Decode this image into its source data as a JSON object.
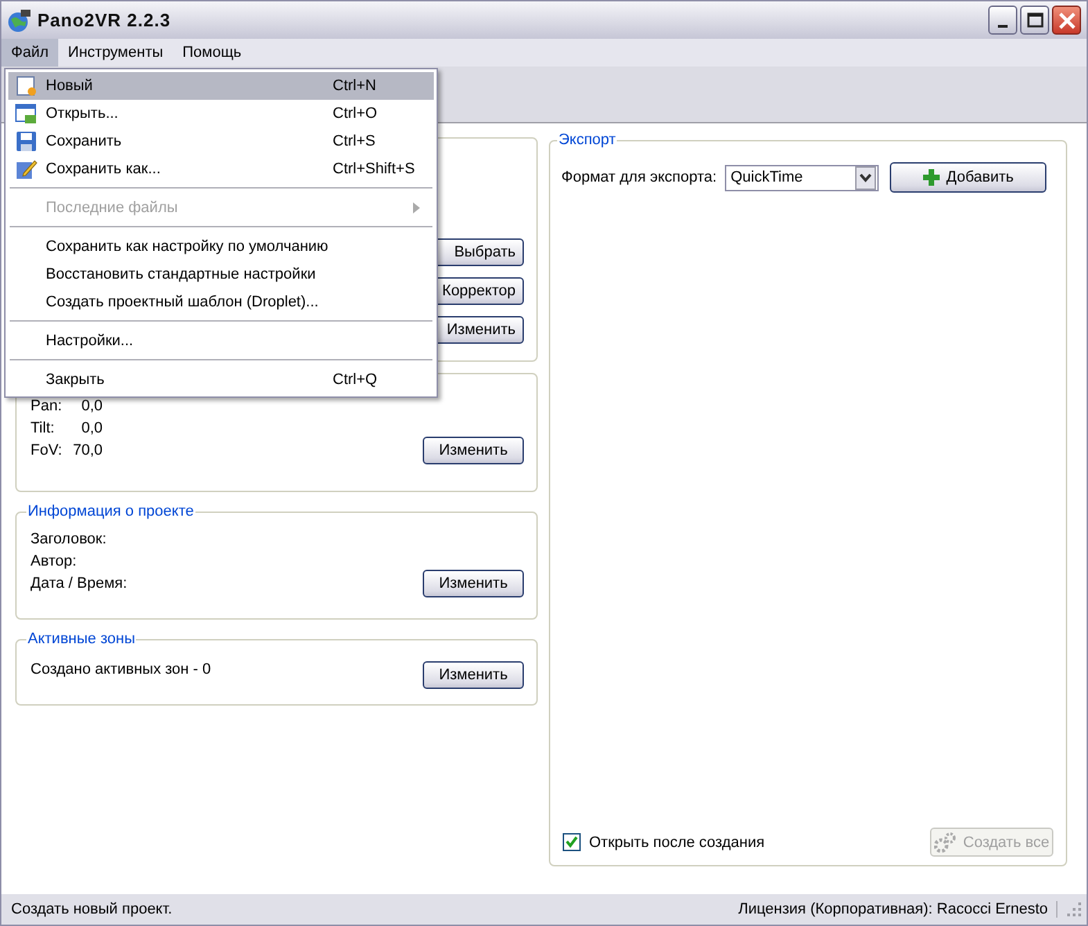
{
  "window": {
    "title": "Pano2VR 2.2.3"
  },
  "menubar": [
    {
      "label": "Файл",
      "selected": true
    },
    {
      "label": "Инструменты",
      "selected": false
    },
    {
      "label": "Помощь",
      "selected": false
    }
  ],
  "file_menu": {
    "items": [
      {
        "kind": "item",
        "label": "Новый",
        "shortcut": "Ctrl+N",
        "selected": true,
        "disabled": false
      },
      {
        "kind": "item",
        "label": "Открыть...",
        "shortcut": "Ctrl+O",
        "selected": false,
        "disabled": false
      },
      {
        "kind": "item",
        "label": "Сохранить",
        "shortcut": "Ctrl+S",
        "selected": false,
        "disabled": false
      },
      {
        "kind": "item",
        "label": "Сохранить как...",
        "shortcut": "Ctrl+Shift+S",
        "selected": false,
        "disabled": false
      },
      {
        "kind": "separator"
      },
      {
        "kind": "submenu",
        "label": "Последние файлы",
        "selected": false,
        "disabled": true
      },
      {
        "kind": "separator"
      },
      {
        "kind": "item",
        "label": "Сохранить как настройку по умолчанию",
        "selected": false,
        "disabled": false
      },
      {
        "kind": "item",
        "label": "Восстановить стандартные настройки",
        "selected": false,
        "disabled": false
      },
      {
        "kind": "item",
        "label": "Создать проектный шаблон (Droplet)...",
        "selected": false,
        "disabled": false
      },
      {
        "kind": "separator"
      },
      {
        "kind": "item",
        "label": "Настройки...",
        "selected": false,
        "disabled": false
      },
      {
        "kind": "separator"
      },
      {
        "kind": "item",
        "label": "Закрыть",
        "shortcut": "Ctrl+Q",
        "selected": false,
        "disabled": false
      }
    ]
  },
  "view_panel": {
    "buttons": [
      "Выбрать",
      "Корректор",
      "Изменить"
    ]
  },
  "position_panel": {
    "rows": [
      {
        "label": "Pan:",
        "value": "0,0"
      },
      {
        "label": "Tilt:",
        "value": "0,0"
      },
      {
        "label": "FoV:",
        "value": "70,0"
      }
    ],
    "button": "Изменить"
  },
  "project_info": {
    "title": "Информация о проекте",
    "fields": [
      "Заголовок:",
      "Автор:",
      "Дата / Время:"
    ],
    "button": "Изменить"
  },
  "hotspots": {
    "title": "Активные зоны",
    "text": "Создано активных зон - 0",
    "button": "Изменить"
  },
  "export": {
    "title": "Экспорт",
    "format_label": "Формат для экспорта:",
    "format": "QuickTime",
    "add_button": "Добавить",
    "open_after": {
      "label": "Открыть после создания",
      "checked": true
    },
    "create_all": {
      "label": "Создать все",
      "disabled": true
    }
  },
  "status_bar": {
    "message": "Создать новый проект.",
    "license": "Лицензия (Корпоративная): Racocci Ernesto"
  }
}
